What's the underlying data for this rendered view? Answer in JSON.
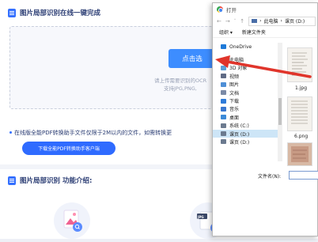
{
  "page": {
    "title": "图片局部识别在线一键完成",
    "upload_button": "点击选",
    "hint_line1": "请上传需要识别的OCR",
    "hint_line2": "支持JPG,PNG,",
    "notice": "在线版全能PDF转换助手文件仅限于2M以内的文件，如需转换更",
    "download_button": "下载全能PDF转换助手客户端",
    "feature_title": "图片局部识别 功能介绍:",
    "feature2_badge": "JPG"
  },
  "dialog": {
    "title": "打开",
    "breadcrumb": [
      "此电脑",
      "课页 (D:)"
    ],
    "toolbar": {
      "organize": "组织 ▾",
      "new_folder": "新建文件夹"
    },
    "nav_items": [
      {
        "label": "OneDrive",
        "icon": "cloud-icon",
        "color": "#1e7ad8"
      },
      {
        "label": "此电脑",
        "icon": "computer-icon",
        "color": "#4a6ea8"
      },
      {
        "label": "3D 对象",
        "icon": "3d-objects-icon",
        "color": "#5aa0d8"
      },
      {
        "label": "视频",
        "icon": "video-icon",
        "color": "#5f6b85"
      },
      {
        "label": "图片",
        "icon": "picture-icon",
        "color": "#4f8fd6"
      },
      {
        "label": "文档",
        "icon": "document-icon",
        "color": "#7b8aa6"
      },
      {
        "label": "下载",
        "icon": "download-icon",
        "color": "#2f7bd9"
      },
      {
        "label": "音乐",
        "icon": "music-icon",
        "color": "#3a77cf"
      },
      {
        "label": "桌面",
        "icon": "desktop-icon",
        "color": "#3c8ad8"
      },
      {
        "label": "系统 (C:)",
        "icon": "drive-icon",
        "color": "#6b7a8f"
      },
      {
        "label": "课页 (D:)",
        "icon": "drive-icon",
        "color": "#6b7a8f",
        "selected": true
      },
      {
        "label": "课页 (D:)",
        "icon": "drive-icon",
        "color": "#6b7a8f"
      }
    ],
    "files": [
      {
        "name": "1.jpg"
      },
      {
        "name": "6.png"
      }
    ],
    "filename_label": "文件名(N):",
    "filename_value": ""
  },
  "colors": {
    "accent": "#3d8dff",
    "arrow": "#e0352b"
  }
}
